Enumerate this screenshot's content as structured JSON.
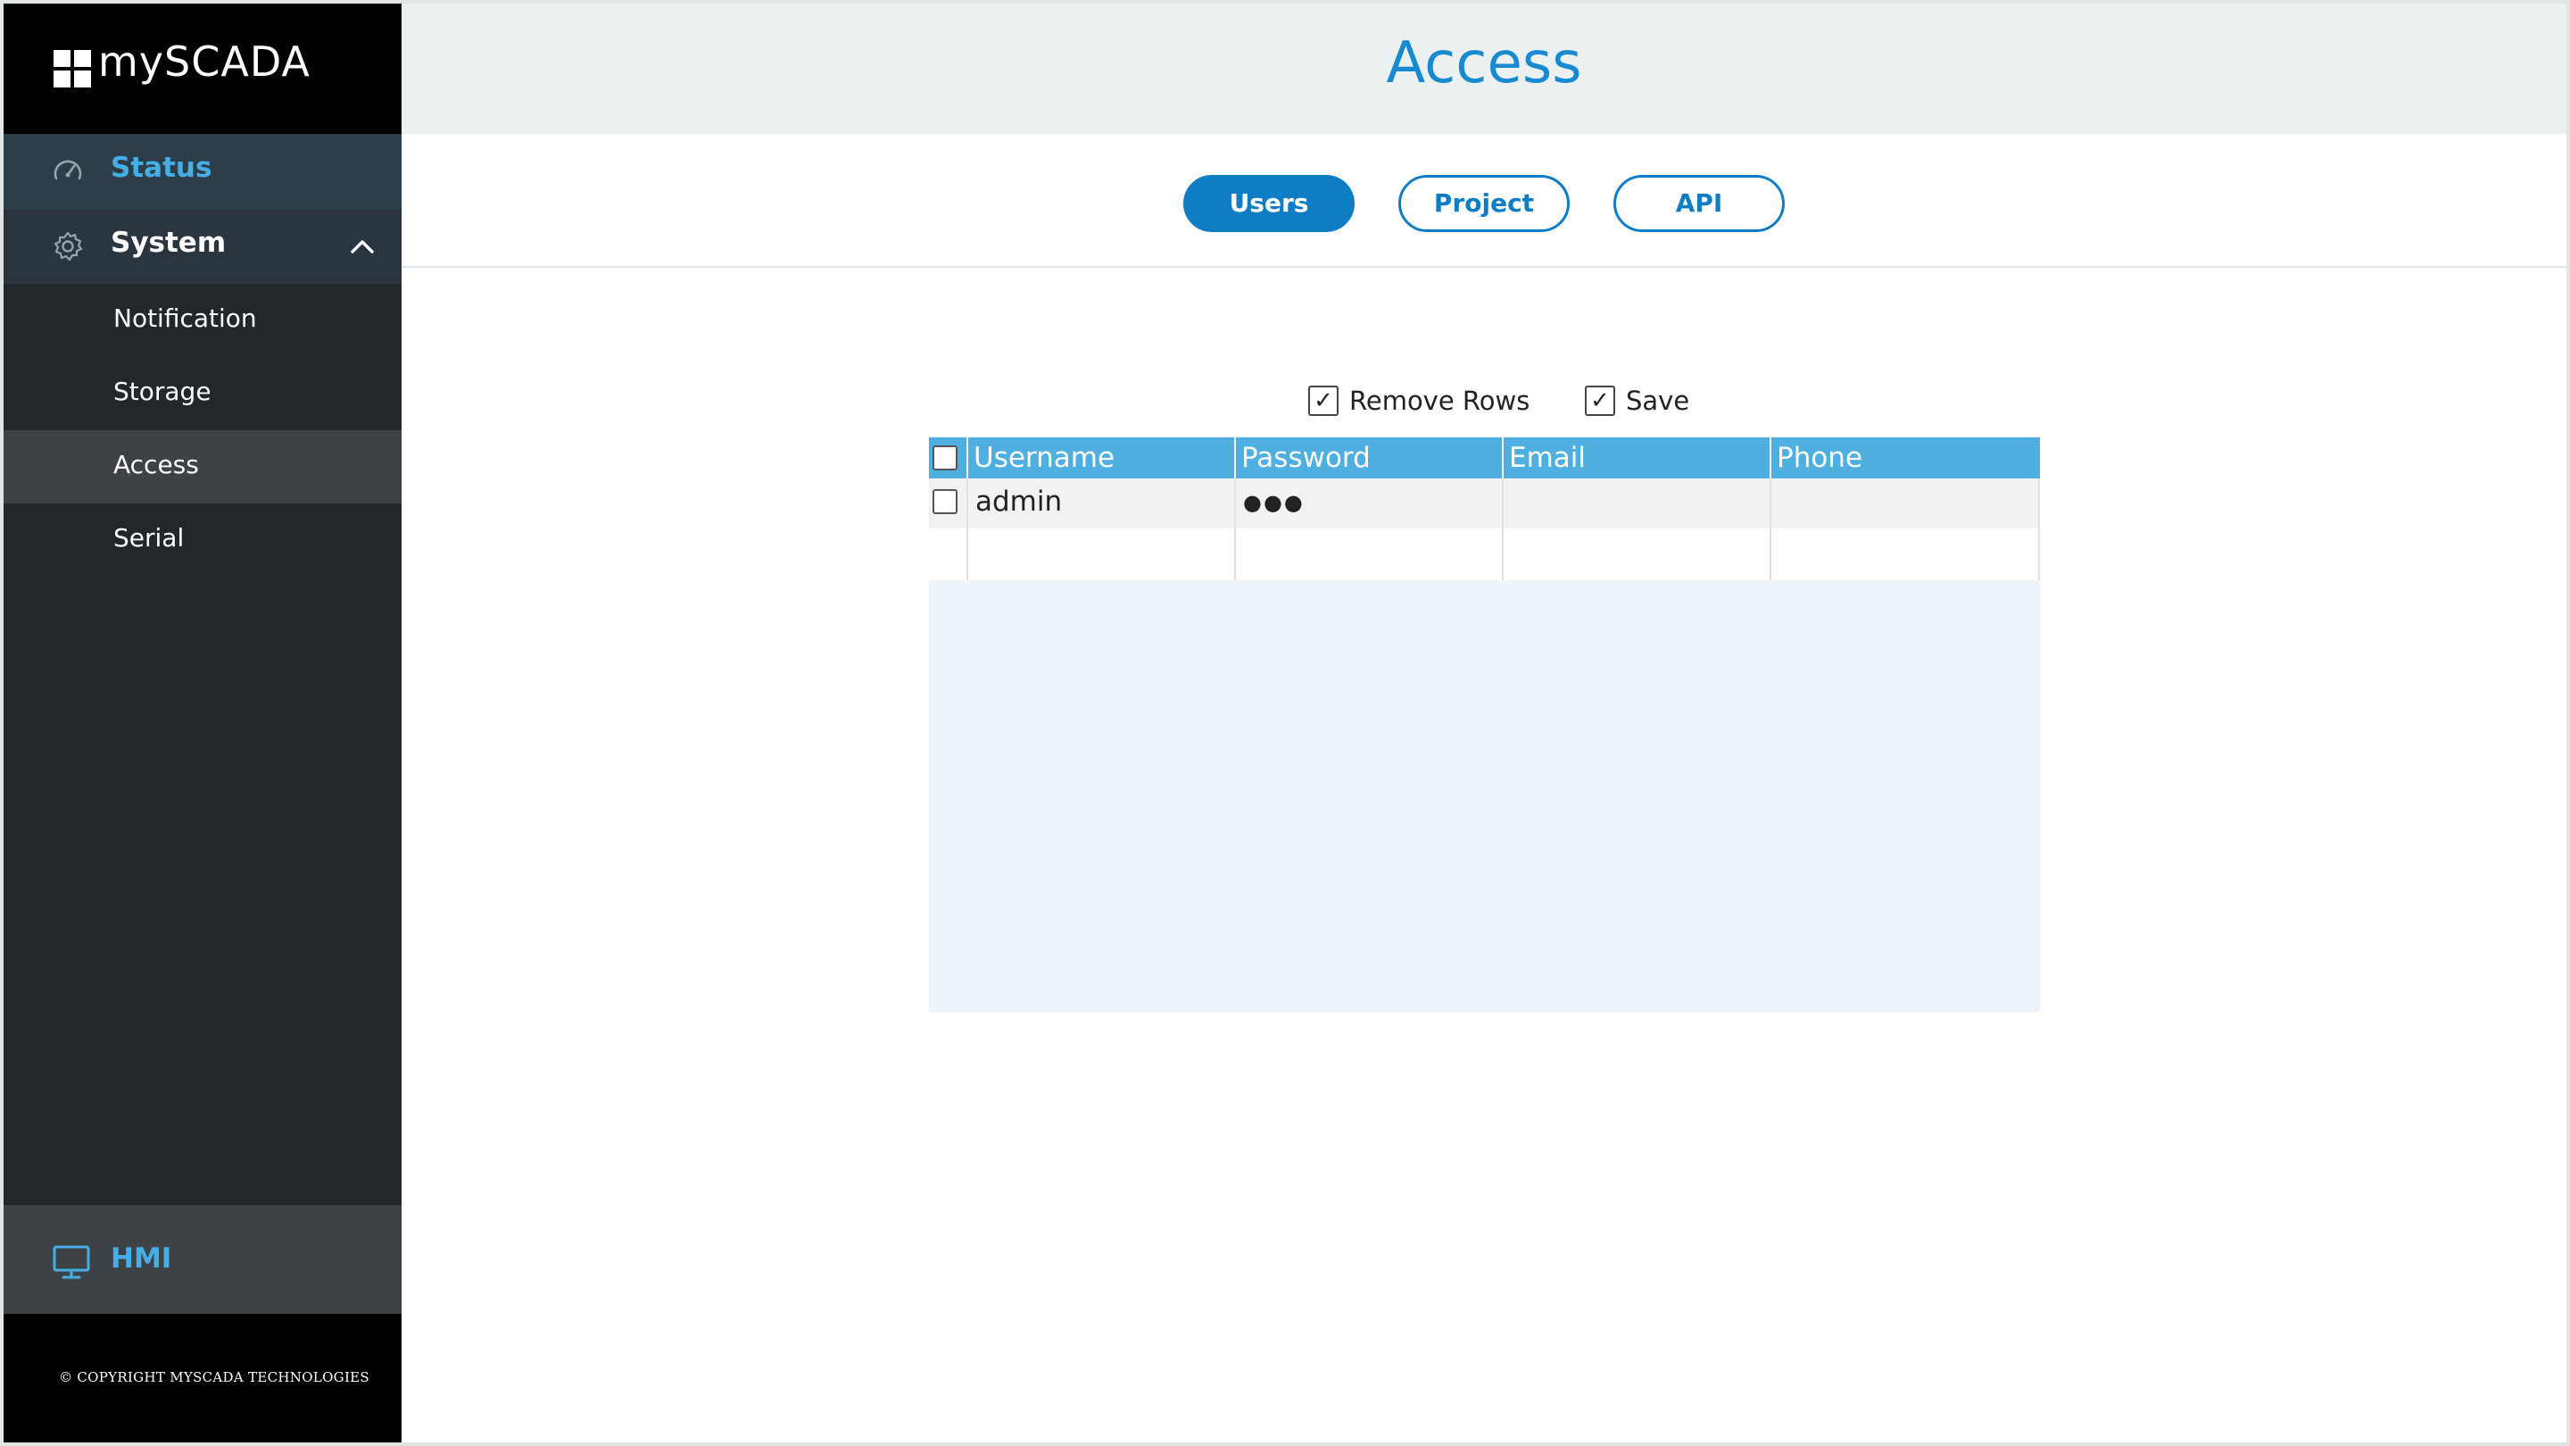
{
  "brand": {
    "name": "mySCADA"
  },
  "sidebar": {
    "status_label": "Status",
    "system_label": "System",
    "items": [
      {
        "label": "Notification"
      },
      {
        "label": "Storage"
      },
      {
        "label": "Access"
      },
      {
        "label": "Serial"
      }
    ],
    "hmi_label": "HMI",
    "copyright": "© COPYRIGHT MYSCADA TECHNOLOGIES"
  },
  "header": {
    "title": "Access"
  },
  "tabs": [
    {
      "label": "Users",
      "active": true
    },
    {
      "label": "Project",
      "active": false
    },
    {
      "label": "API",
      "active": false
    }
  ],
  "toolbar": {
    "remove_rows_label": "Remove Rows",
    "save_label": "Save",
    "check_glyph": "✓"
  },
  "table": {
    "columns": [
      "Username",
      "Password",
      "Email",
      "Phone"
    ],
    "rows": [
      {
        "username": "admin",
        "password": "●●●",
        "email": "",
        "phone": ""
      }
    ]
  },
  "colors": {
    "accent": "#0f7dc4",
    "sidebar": "#22272b",
    "grid_header": "#4eafe0",
    "status_text": "#45aee6"
  }
}
